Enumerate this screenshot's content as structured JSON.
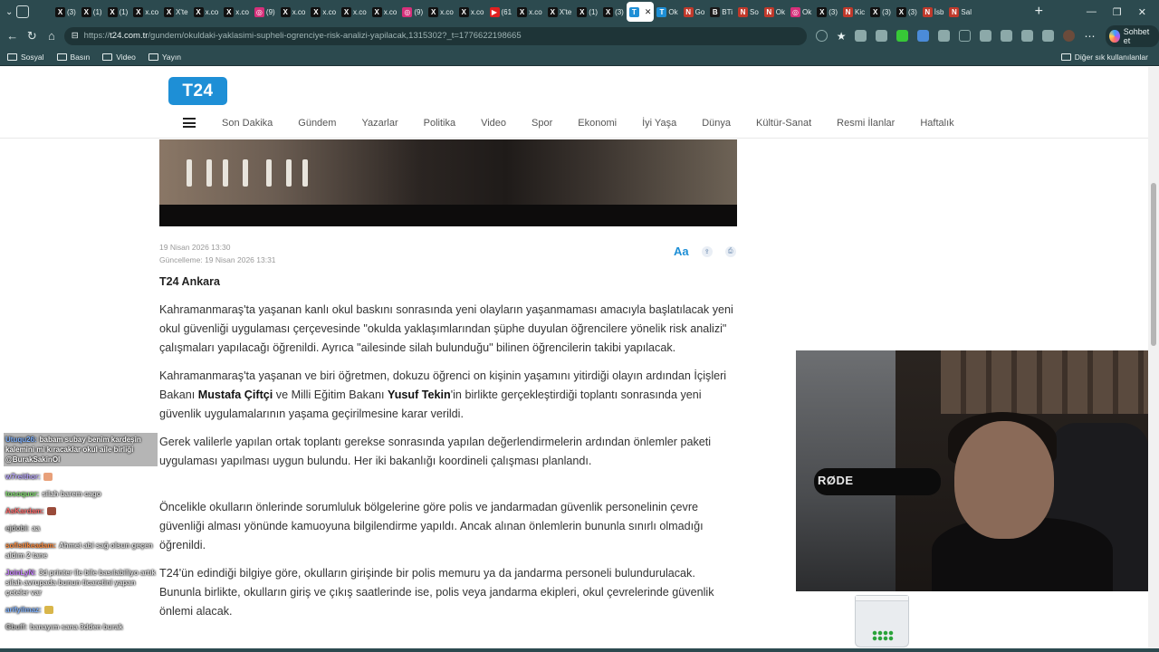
{
  "browser": {
    "tabs": [
      {
        "icon": "x-icon",
        "label": "(3)"
      },
      {
        "icon": "x-icon",
        "label": "(1)"
      },
      {
        "icon": "x-icon",
        "label": "(1)"
      },
      {
        "icon": "x-icon",
        "label": "x.co"
      },
      {
        "icon": "x-icon",
        "label": "X'te"
      },
      {
        "icon": "x-icon",
        "label": "x.co"
      },
      {
        "icon": "x-icon",
        "label": "x.co"
      },
      {
        "icon": "instagram-icon",
        "label": "(9)"
      },
      {
        "icon": "x-icon",
        "label": "x.co"
      },
      {
        "icon": "x-icon",
        "label": "x.co"
      },
      {
        "icon": "x-icon",
        "label": "x.co"
      },
      {
        "icon": "x-icon",
        "label": "x.co"
      },
      {
        "icon": "instagram-icon",
        "label": "(9)"
      },
      {
        "icon": "x-icon",
        "label": "x.co"
      },
      {
        "icon": "x-icon",
        "label": "x.co"
      },
      {
        "icon": "youtube-icon",
        "label": "(61"
      },
      {
        "icon": "x-icon",
        "label": "x.co"
      },
      {
        "icon": "x-icon",
        "label": "X'te"
      },
      {
        "icon": "x-icon",
        "label": "(1)"
      },
      {
        "icon": "x-icon",
        "label": "(3)"
      },
      {
        "icon": "t24-icon",
        "label": "",
        "active": true
      },
      {
        "icon": "t24-icon",
        "label": "Ok"
      },
      {
        "icon": "news-icon",
        "label": "Go"
      },
      {
        "icon": "bti-icon",
        "label": "BTi"
      },
      {
        "icon": "news-icon",
        "label": "So"
      },
      {
        "icon": "news-icon",
        "label": "Ok"
      },
      {
        "icon": "instagram-icon",
        "label": "Ok"
      },
      {
        "icon": "x-icon",
        "label": "(3)"
      },
      {
        "icon": "news-icon",
        "label": "Kic"
      },
      {
        "icon": "x-icon",
        "label": "(3)"
      },
      {
        "icon": "x-icon",
        "label": "(3)"
      },
      {
        "icon": "news-icon",
        "label": "İsb"
      },
      {
        "icon": "news-icon",
        "label": "Sal"
      }
    ],
    "url_host": "t24.com.tr",
    "url_path": "/gundem/okuldaki-yaklasimi-supheli-ogrenciye-risk-analizi-yapilacak,1315302?_t=1776622198665",
    "url_scheme": "https://",
    "copilot_label": "Sohbet et",
    "bookmarks": [
      "Sosyal",
      "Basın",
      "Video",
      "Yayın"
    ],
    "other_bookmarks": "Diğer sık kullanılanlar"
  },
  "site": {
    "logo": "T24",
    "menu": [
      "Son Dakika",
      "Gündem",
      "Yazarlar",
      "Politika",
      "Video",
      "Spor",
      "Ekonomi",
      "İyi Yaşa",
      "Dünya",
      "Kültür-Sanat",
      "Resmi İlanlar",
      "Haftalık"
    ]
  },
  "article": {
    "published": "19 Nisan 2026 13:30",
    "updated": "Güncelleme: 19 Nisan 2026 13:31",
    "font_tool": "Aa",
    "location": "T24 Ankara",
    "p1": "Kahramanmaraş'ta yaşanan kanlı okul baskını sonrasında yeni olayların yaşanmaması amacıyla başlatılacak yeni okul güvenliği uygulaması çerçevesinde \"okulda yaklaşımlarından şüphe duyulan öğrencilere yönelik risk analizi\" çalışmaları yapılacağı öğrenildi. Ayrıca \"ailesinde silah bulunduğu\" bilinen öğrencilerin takibi yapılacak.",
    "p2_a": "Kahramanmaraş'ta yaşanan ve biri öğretmen, dokuzu öğrenci on kişinin yaşamını yitirdiği olayın ardından İçişleri Bakanı ",
    "p2_b": "Mustafa Çiftçi",
    "p2_c": " ve Milli Eğitim Bakanı ",
    "p2_d": "Yusuf Tekin",
    "p2_e": "'in birlikte gerçekleştirdiği toplantı sonrasında yeni güvenlik uygulamalarının yaşama geçirilmesine karar verildi.",
    "p3": "Gerek valilerle yapılan ortak toplantı gerekse sonrasında yapılan değerlendirmelerin ardından önlemler paketi uygulaması yapılması uygun bulundu. Her iki bakanlığı koordineli çalışması planlandı.",
    "p4": "Öncelikle okulların önlerinde sorumluluk bölgelerine göre polis ve jandarmadan güvenlik personelinin çevre güvenliği alması yönünde kamuoyuna bilgilendirme yapıldı. Ancak alınan önlemlerin bununla sınırlı olmadığı öğrenildi.",
    "p5": "T24'ün edindiği bilgiye göre, okulların girişinde bir polis memuru ya da jandarma personeli bulundurulacak. Bununla birlikte, okulların giriş ve çıkış saatlerinde ise, polis veya jandarma ekipleri, okul çevrelerinde güvenlik önlemi alacak."
  },
  "chat": [
    {
      "user": "Utuqu26:",
      "text": "babam subay benim kardeşin kalemini mi kıracaklar okul aile birliği @BurakSakinOl",
      "color": "#7fb2ff",
      "highlight": true
    },
    {
      "user": "w7reithor:",
      "text": "",
      "color": "#b9a6ff",
      "emote": "#e8a07a"
    },
    {
      "user": "tosoquor:",
      "text": "silah barem cago",
      "color": "#7ddc6a"
    },
    {
      "user": "AsKardam:",
      "text": "",
      "color": "#ff6a6a",
      "emote": "#9a4b3a"
    },
    {
      "user": "ejdobi:",
      "text": "aa",
      "color": "#c4c4c4"
    },
    {
      "user": "sofistikeadam:",
      "text": "Ahmet abi sağ olsun geçen aldım 2 tane",
      "color": "#ff8a3a"
    },
    {
      "user": "JoinLyN:",
      "text": "3d printer ile bile basılabiliyo artık silah avrupada bunun ticaretini yapan çeteler var",
      "color": "#c77dff"
    },
    {
      "user": "arifyilmaz:",
      "text": "",
      "color": "#7fb2ff",
      "emote": "#d9b64a"
    },
    {
      "user": "Gbuff:",
      "text": "banayım sana 3dden burak",
      "color": "#c4c4c4"
    }
  ],
  "webcam": {
    "mic_brand": "RØDE"
  },
  "colors": {
    "chrome": "#2c4a4f",
    "t24_blue": "#1e8fd6"
  }
}
